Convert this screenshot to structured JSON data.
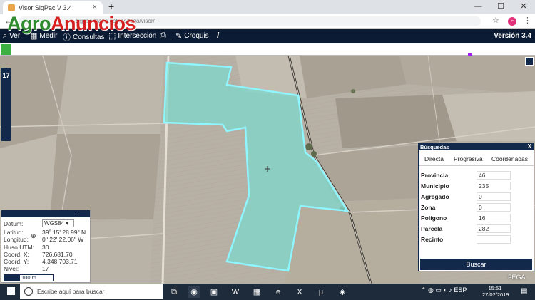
{
  "browser": {
    "tab_title": "Visor SigPac V 3.4",
    "tab_close": "×",
    "new_tab": "+",
    "address": "sigpac.mapa.gob.es/fega/visor/",
    "window_controls": [
      "—",
      "☐",
      "✕"
    ],
    "profile_initial": "F"
  },
  "watermark": {
    "part1": "Agro",
    "part2": "Anuncios"
  },
  "toolbar": {
    "items": [
      {
        "icon": "search-icon",
        "glyph": "⌕",
        "label": "Ver"
      },
      {
        "icon": "ruler-icon",
        "glyph": "▦",
        "label": "Medir"
      },
      {
        "icon": "info-icon",
        "glyph": "ⓘ",
        "label": "Consultas"
      },
      {
        "icon": "intersection-icon",
        "glyph": "⬚",
        "label": "Intersección"
      },
      {
        "icon": "print-icon",
        "glyph": "⎙",
        "label": ""
      },
      {
        "icon": "pencil-icon",
        "glyph": "✎",
        "label": "Croquis"
      },
      {
        "icon": "italic-info-icon",
        "glyph": "i",
        "label": ""
      }
    ],
    "version": "Versión 3.4"
  },
  "zoom_level": "17",
  "coordinates": {
    "minimize": "—",
    "datum_label": "Datum:",
    "datum_value": "WGS84",
    "latitud_label": "Latitud:",
    "latitud_value": "39º 15' 28.99\" N",
    "longitud_label": "Longitud:",
    "longitud_value": "0º 22' 22.06\" W",
    "huso_label": "Huso UTM:",
    "huso_value": "30",
    "coordx_label": "Coord. X:",
    "coordx_value": "726.681,70",
    "coordy_label": "Coord. Y:",
    "coordy_value": "4.348.703,71",
    "nivel_label": "Nivel:",
    "nivel_value": "17",
    "scale": "100 m"
  },
  "search": {
    "title": "Búsquedas",
    "close": "X",
    "tabs": [
      "Directa",
      "Progresiva",
      "Coordenadas"
    ],
    "fields": [
      {
        "label": "Provincia",
        "value": "46"
      },
      {
        "label": "Municipio",
        "value": "235"
      },
      {
        "label": "Agregado",
        "value": "0"
      },
      {
        "label": "Zona",
        "value": "0"
      },
      {
        "label": "Polígono",
        "value": "16"
      },
      {
        "label": "Parcela",
        "value": "282"
      },
      {
        "label": "Recinto",
        "value": ""
      }
    ],
    "button": "Buscar"
  },
  "fega_label": "FEGA",
  "taskbar": {
    "search_placeholder": "Escribe aquí para buscar",
    "time": "15:51",
    "date": "27/02/2019"
  },
  "colors": {
    "navy": "#0b1b33",
    "parcel_fill": "#7fd8cc",
    "parcel_border": "#8ff5ff",
    "start_green": "#3cb043"
  }
}
